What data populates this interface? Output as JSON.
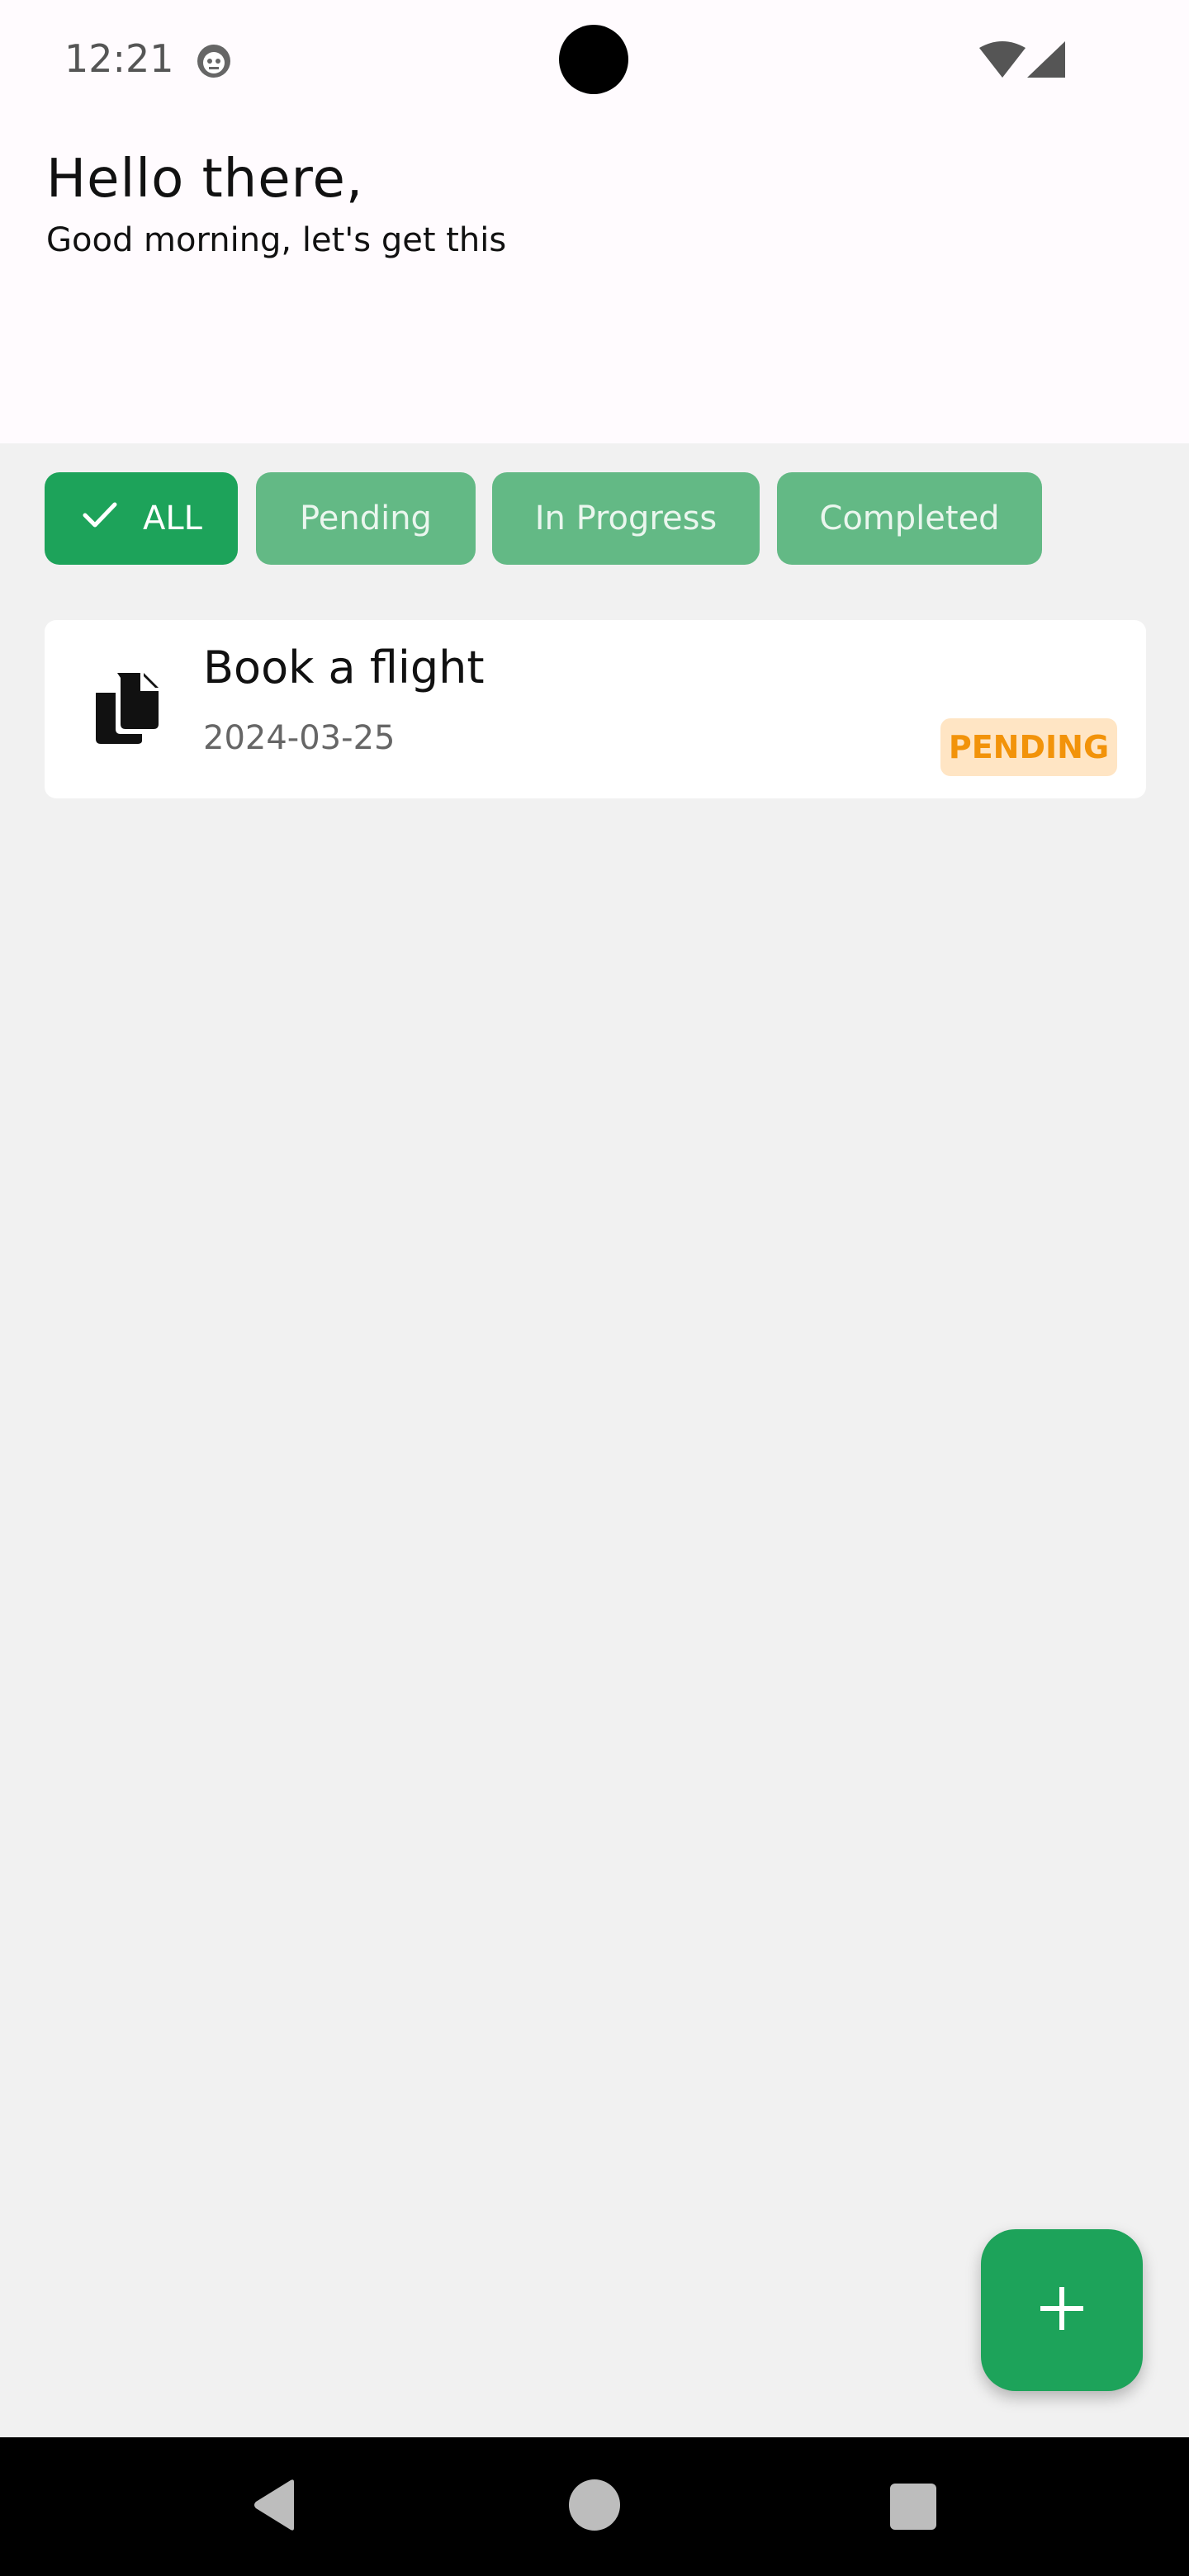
{
  "status_bar": {
    "time": "12:21",
    "notification_icon": "cat-face-icon",
    "wifi_icon": "wifi-icon",
    "signal_icon": "cell-signal-icon"
  },
  "header": {
    "title": "Hello there,",
    "subtitle": "Good morning, let's get this"
  },
  "filters": {
    "chips": [
      {
        "label": "ALL",
        "selected": true
      },
      {
        "label": "Pending",
        "selected": false
      },
      {
        "label": "In Progress",
        "selected": false
      },
      {
        "label": "Completed",
        "selected": false
      }
    ]
  },
  "tasks": [
    {
      "icon": "documents-icon",
      "title": "Book a flight",
      "date": "2024-03-25",
      "status": "PENDING"
    }
  ],
  "fab": {
    "icon": "plus-icon"
  },
  "navigation": {
    "back_icon": "back-triangle-icon",
    "home_icon": "home-circle-icon",
    "recents_icon": "recents-square-icon"
  },
  "colors": {
    "accent_green": "#1da35a",
    "chip_unselected": "#63b985",
    "badge_bg": "#ffe5c4",
    "badge_text": "#f2930a",
    "header_bg": "#fffbfe",
    "page_bg": "#f1f1f1"
  }
}
